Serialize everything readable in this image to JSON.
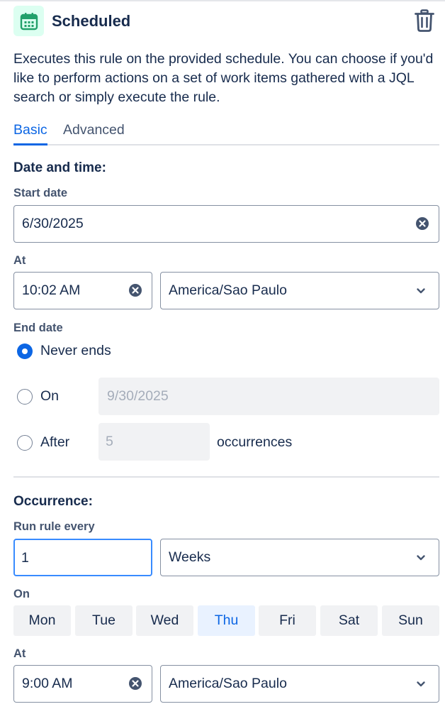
{
  "header": {
    "title": "Scheduled",
    "icon": "calendar-icon",
    "icon_color": "#22a06b",
    "delete_icon": "trash-icon"
  },
  "description": "Executes this rule on the provided schedule. You can choose if you'd like to perform actions on a set of work items gathered with a JQL search or simply execute the rule.",
  "tabs": [
    {
      "label": "Basic",
      "selected": true
    },
    {
      "label": "Advanced",
      "selected": false
    }
  ],
  "date_time": {
    "heading": "Date and time:",
    "start_date_label": "Start date",
    "start_date_value": "6/30/2025",
    "at_label": "At",
    "time_value": "10:02 AM",
    "timezone_value": "America/Sao Paulo",
    "end_date_label": "End date",
    "end_options": {
      "never": "Never ends",
      "on": "On",
      "on_date": "9/30/2025",
      "after": "After",
      "after_count": "5",
      "occurrences_suffix": "occurrences"
    },
    "selected_end_option": "never"
  },
  "occurrence": {
    "heading": "Occurrence:",
    "run_every_label": "Run rule every",
    "interval_value": "1",
    "unit_value": "Weeks",
    "on_label": "On",
    "days": [
      "Mon",
      "Tue",
      "Wed",
      "Thu",
      "Fri",
      "Sat",
      "Sun"
    ],
    "selected_day": "Thu",
    "at_label": "At",
    "time_value": "9:00 AM",
    "timezone_value": "America/Sao Paulo"
  },
  "colors": {
    "accent": "#0c66e4",
    "text": "#172b4d",
    "subtle_text": "#44546f"
  }
}
